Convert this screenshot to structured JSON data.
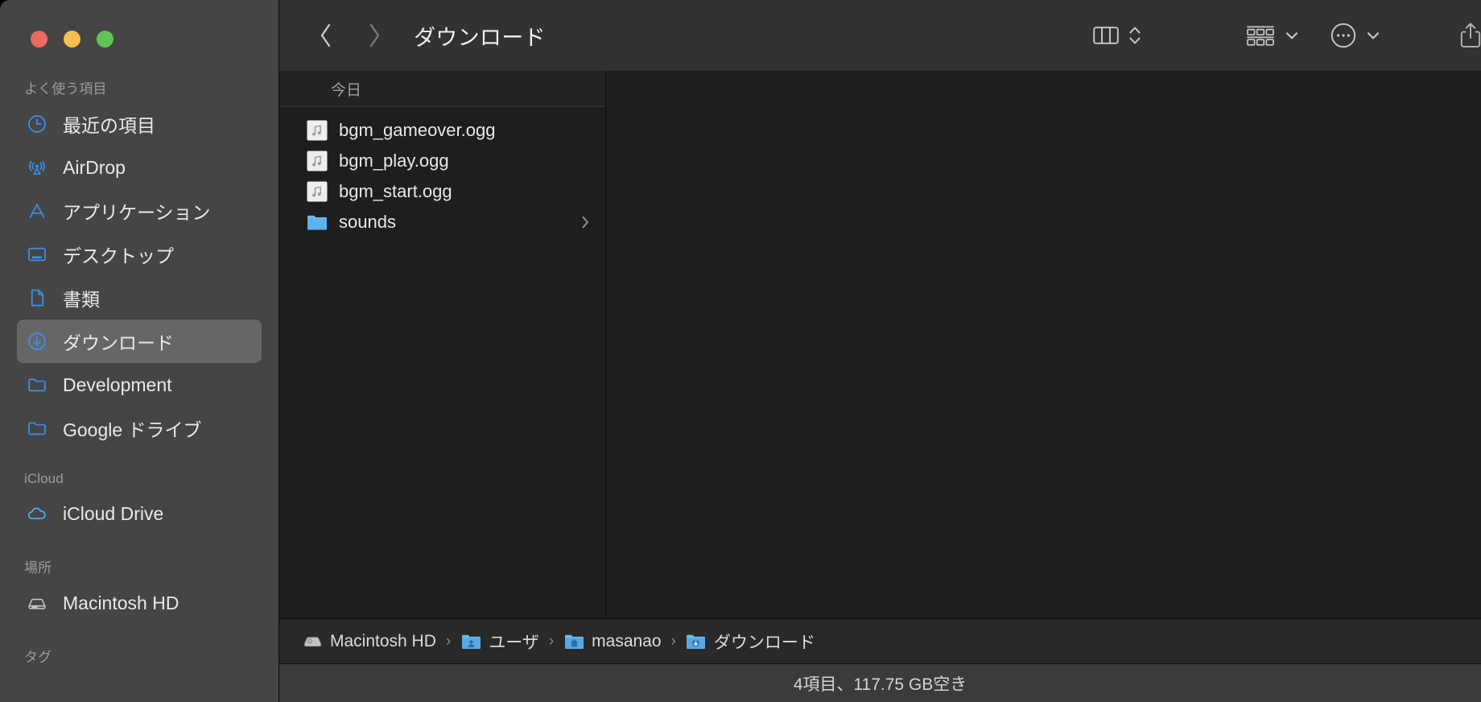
{
  "window": {
    "title": "ダウンロード",
    "traffic_lights": [
      {
        "name": "close",
        "color": "#ec6a5f"
      },
      {
        "name": "minimize",
        "color": "#f5bf4f"
      },
      {
        "name": "maximize",
        "color": "#61c555"
      }
    ]
  },
  "colors": {
    "sidebar_bg": "#454545",
    "toolbar_bg": "#323232",
    "content_bg": "#1e1e1e",
    "pathbar_bg": "#292929",
    "statusbar_bg": "#3b3b3b",
    "accent": "#3b90f0",
    "selected_row": "#666666"
  },
  "sidebar": {
    "groups": [
      {
        "title": "よく使う項目",
        "items": [
          {
            "label": "最近の項目",
            "icon": "clock-icon",
            "selected": false
          },
          {
            "label": "AirDrop",
            "icon": "airdrop-icon",
            "selected": false
          },
          {
            "label": "アプリケーション",
            "icon": "applications-icon",
            "selected": false
          },
          {
            "label": "デスクトップ",
            "icon": "desktop-icon",
            "selected": false
          },
          {
            "label": "書類",
            "icon": "document-icon",
            "selected": false
          },
          {
            "label": "ダウンロード",
            "icon": "downloads-icon",
            "selected": true
          },
          {
            "label": "Development",
            "icon": "folder-icon",
            "selected": false
          },
          {
            "label": "Google ドライブ",
            "icon": "folder-icon",
            "selected": false
          }
        ]
      },
      {
        "title": "iCloud",
        "items": [
          {
            "label": "iCloud Drive",
            "icon": "cloud-icon",
            "selected": false
          }
        ]
      },
      {
        "title": "場所",
        "items": [
          {
            "label": "Macintosh HD",
            "icon": "harddisk-icon",
            "selected": false
          }
        ]
      },
      {
        "title": "タグ",
        "items": []
      }
    ]
  },
  "toolbar": {
    "back_label": "戻る",
    "forward_label": "進む",
    "title": "ダウンロード",
    "buttons": [
      {
        "name": "view-column-button",
        "icon": "column-view-icon"
      },
      {
        "name": "view-options-stepper",
        "icon": "chevron-up-down-icon"
      },
      {
        "name": "group-by-button",
        "icon": "group-grid-icon"
      },
      {
        "name": "group-by-chevron",
        "icon": "chevron-down-icon"
      },
      {
        "name": "more-actions-button",
        "icon": "ellipsis-circle-icon"
      },
      {
        "name": "more-actions-chevron",
        "icon": "chevron-down-icon"
      },
      {
        "name": "share-button",
        "icon": "share-icon"
      },
      {
        "name": "tag-button",
        "icon": "tag-icon"
      },
      {
        "name": "overflow-chevron",
        "icon": "chevron-down-icon"
      },
      {
        "name": "search-button",
        "icon": "search-icon"
      }
    ]
  },
  "column": {
    "header": "今日",
    "files": [
      {
        "name": "bgm_gameover.ogg",
        "icon": "audio-file-icon",
        "has_chevron": false
      },
      {
        "name": "bgm_play.ogg",
        "icon": "audio-file-icon",
        "has_chevron": false
      },
      {
        "name": "bgm_start.ogg",
        "icon": "audio-file-icon",
        "has_chevron": false
      },
      {
        "name": "sounds",
        "icon": "folder-icon",
        "has_chevron": true
      }
    ]
  },
  "pathbar": {
    "segments": [
      {
        "label": "Macintosh HD",
        "icon": "harddisk-icon"
      },
      {
        "label": "ユーザ",
        "icon": "users-folder-icon"
      },
      {
        "label": "masanao",
        "icon": "home-folder-icon"
      },
      {
        "label": "ダウンロード",
        "icon": "downloads-folder-icon"
      }
    ],
    "separator": "›"
  },
  "statusbar": {
    "text": "4項目、117.75 GB空き"
  }
}
